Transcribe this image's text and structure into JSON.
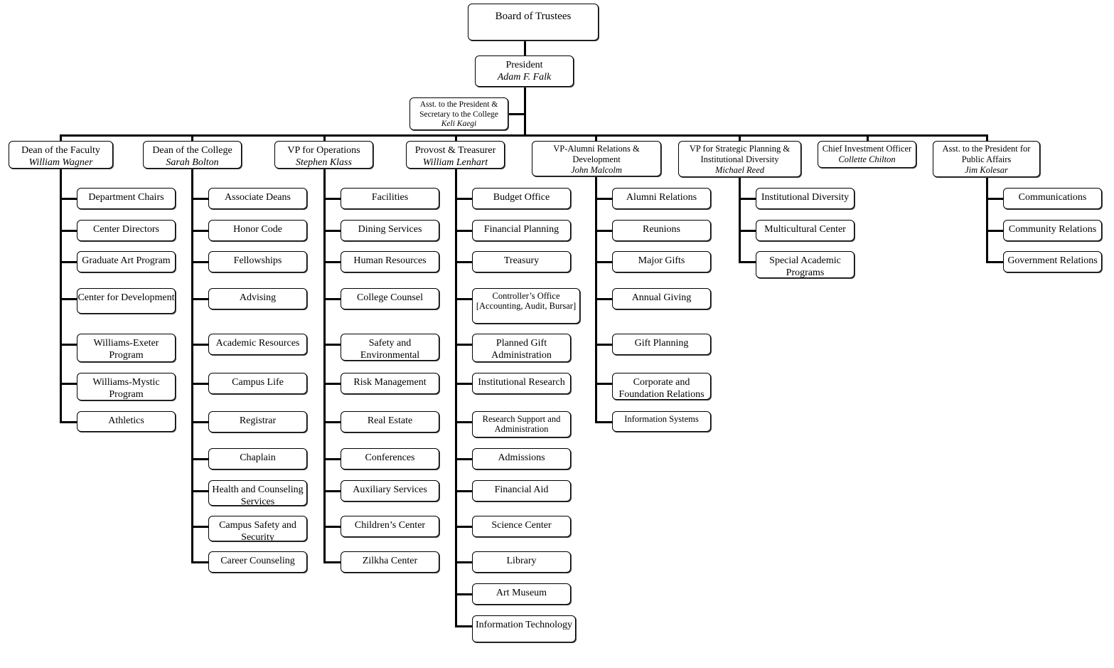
{
  "board": {
    "title": "Board of Trustees"
  },
  "president": {
    "title": "President",
    "name": "Adam F. Falk"
  },
  "assistant": {
    "title": "Asst. to the President & Secretary to the College",
    "name": "Keli Kaegi"
  },
  "departments": [
    {
      "title": "Dean of the Faculty",
      "name": "William Wagner",
      "children": [
        "Department Chairs",
        "Center Directors",
        "Graduate Art Program",
        "Center for Development",
        "Williams-Exeter Program",
        "Williams-Mystic Program",
        "Athletics"
      ]
    },
    {
      "title": "Dean of the College",
      "name": "Sarah Bolton",
      "children": [
        "Associate Deans",
        "Honor Code",
        "Fellowships",
        "Advising",
        "Academic Resources",
        "Campus Life",
        "Registrar",
        "Chaplain",
        "Health and Counseling Services",
        "Campus Safety and Security",
        "Career Counseling"
      ]
    },
    {
      "title": "VP for Operations",
      "name": "Stephen Klass",
      "children": [
        "Facilities",
        "Dining Services",
        "Human Resources",
        "College Counsel",
        "Safety and Environmental",
        "Risk Management",
        "Real Estate",
        "Conferences",
        "Auxiliary Services",
        "Children’s Center",
        "Zilkha Center"
      ]
    },
    {
      "title": "Provost & Treasurer",
      "name": "William Lenhart",
      "children": [
        "Budget Office",
        "Financial Planning",
        "Treasury",
        "Controller’s Office [Accounting, Audit, Bursar]",
        "Planned Gift Administration",
        "Institutional Research",
        "Research Support and Administration",
        "Admissions",
        "Financial Aid",
        "Science Center",
        "Library",
        "Art Museum",
        "Information Technology"
      ]
    },
    {
      "title": "VP-Alumni Relations & Development",
      "name": "John Malcolm",
      "children": [
        "Alumni Relations",
        "Reunions",
        "Major Gifts",
        "Annual Giving",
        "Gift Planning",
        "Corporate and Foundation Relations",
        "Information Systems"
      ]
    },
    {
      "title": "VP for Strategic Planning & Institutional Diversity",
      "name": "Michael Reed",
      "children": [
        "Institutional Diversity",
        "Multicultural Center",
        "Special Academic Programs"
      ]
    },
    {
      "title": "Chief Investment Officer",
      "name": "Collette Chilton",
      "children": []
    },
    {
      "title": "Asst. to the President for Public Affairs",
      "name": "Jim Kolesar",
      "children": [
        "Communications",
        "Community Relations",
        "Government Relations"
      ]
    }
  ]
}
